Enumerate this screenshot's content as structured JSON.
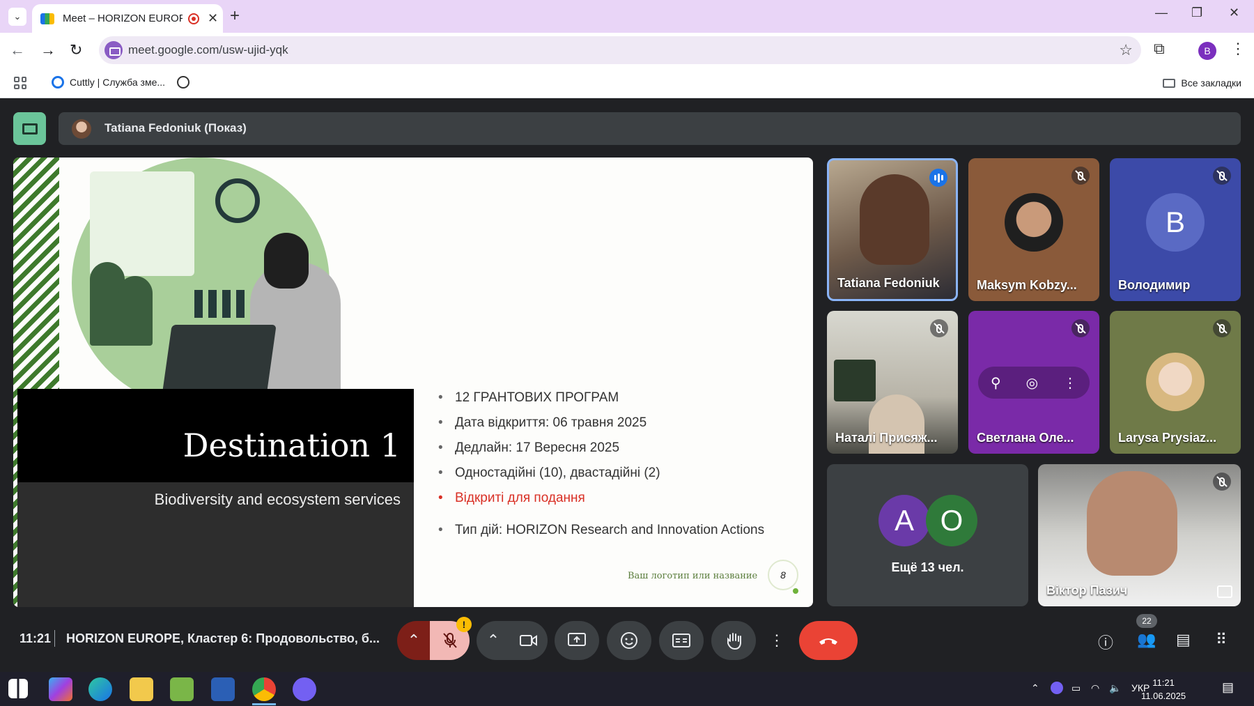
{
  "browser": {
    "tab_title": "Meet – HORIZON EUROPE,",
    "url": "meet.google.com/usw-ujid-yqk",
    "profile_initial": "B",
    "bookmark_1": "Cuttly | Служба зме...",
    "all_bookmarks": "Все закладки"
  },
  "meet": {
    "presenter_label": "Tatiana Fedoniuk (Показ)",
    "time": "11:21",
    "meeting_title": "HORIZON EUROPE, Кластер 6: Продовольство, б...",
    "participant_count": "22",
    "mic_warning": "!"
  },
  "slide": {
    "title": "Destination 1",
    "subtitle": "Biodiversity and ecosystem services",
    "bullets": [
      "12 ГРАНТОВИХ ПРОГРАМ",
      "Дата відкриття: 06 травня 2025",
      "Дедлайн: 17 Вересня 2025",
      "Одностадійні (10), двастадійні (2)",
      "Відкриті для подання",
      "Тип дій: HORIZON Research and Innovation Actions"
    ],
    "logo_text": "Ваш логотип или название",
    "page_number": "8"
  },
  "participants": [
    {
      "name": "Tatiana Fedoniuk",
      "state": "speaking"
    },
    {
      "name": "Maksym Kobzy...",
      "state": "muted"
    },
    {
      "name": "Володимир",
      "state": "muted",
      "initial": "B"
    },
    {
      "name": "Наталі Присяж...",
      "state": "muted"
    },
    {
      "name": "Светлана Оле...",
      "state": "muted"
    },
    {
      "name": "Larysa Prysiaz...",
      "state": "muted"
    },
    {
      "name": "Віктор Пазич",
      "state": "muted"
    }
  ],
  "more_tile": {
    "label": "Ещё 13 чел.",
    "avatar_1": "A",
    "avatar_2": "O"
  },
  "taskbar": {
    "language": "УКР",
    "time": "11:21",
    "date": "11.06.2025"
  },
  "colors": {
    "accent": "#1a73e8",
    "end_call": "#ea4335",
    "tab_strip": "#e9d5f7",
    "slide_green": "#3e7a2c"
  }
}
